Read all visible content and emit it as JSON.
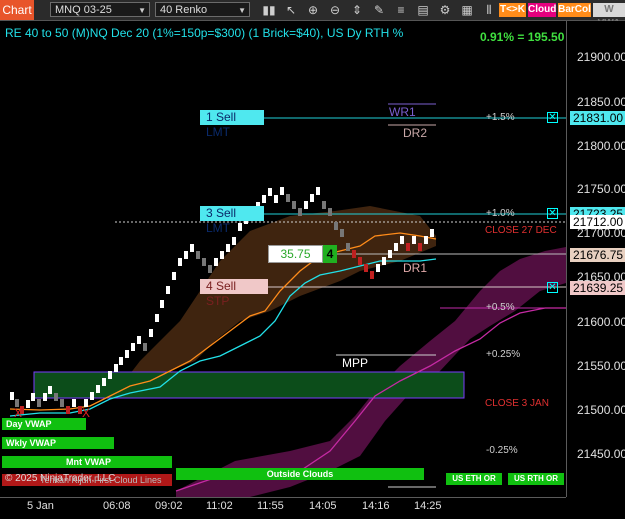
{
  "toolbar": {
    "chart_label": "Chart",
    "instrument": "MNQ 03-25",
    "bar_type": "40 Renko",
    "btn_tk": "T<>K",
    "btn_cloud": "Cloud",
    "btn_barcol": "BarCol",
    "btn_vwap": "W VWA",
    "colors": {
      "tk": "#ff8c1a",
      "cloud": "#e6007e",
      "barcol": "#ff8c1a"
    }
  },
  "chart": {
    "info": "RE 40 to 50 (M)NQ Dec 20 (1%=150p=$300) (1 Brick=$40), US Dy RTH %",
    "pct_readout": "0.91% = 195.50",
    "current_price": "21712.00",
    "copyright": "© 2025 NinjaTrader, LLC",
    "kijun_label": "Tenkan Kijun First Cloud Lines",
    "levels": {
      "wr1": "WR1",
      "dr2": "DR2",
      "dr1": "DR1",
      "mpp": "MPP",
      "close27": "CLOSE 27 DEC",
      "close3": "CLOSE 3 JAN",
      "p15": "+1.5%",
      "p10": "+1.0%",
      "p05": "+0.5%",
      "p025": "+0.25%",
      "m025": "-0.25%"
    },
    "orders": [
      {
        "label": "1 Sell LMT",
        "price": "21831.00"
      },
      {
        "label": "3 Sell LMT",
        "price": "21723.25"
      },
      {
        "label": "4 Sell STP",
        "price": "21639.25"
      }
    ],
    "position": {
      "pnl": "35.75",
      "qty": "4",
      "price": "21676.75"
    },
    "bars": {
      "day_vwap": "Day VWAP",
      "wkly_vwap": "Wkly VWAP",
      "mnt_vwap": "Mnt VWAP",
      "outside_clouds": "Outside Clouds",
      "us_eth_or": "US ETH OR",
      "us_rth_or": "US RTH OR"
    }
  },
  "y_axis": {
    "ticks": [
      "21900.00",
      "21850.00",
      "21800.00",
      "21750.00",
      "21700.00",
      "21650.00",
      "21600.00",
      "21550.00",
      "21500.00",
      "21450.00"
    ]
  },
  "x_axis": {
    "ticks": [
      "5 Jan",
      "06:08",
      "09:02",
      "11:02",
      "11:55",
      "14:05",
      "14:16",
      "14:25"
    ]
  }
}
